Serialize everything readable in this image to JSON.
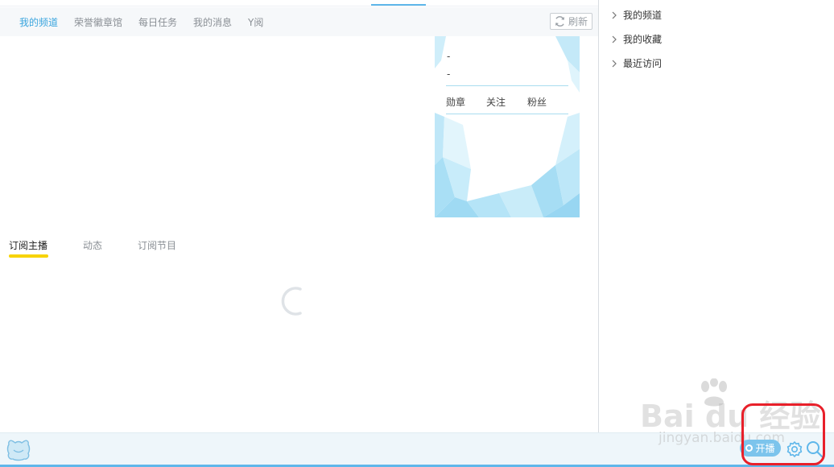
{
  "nav": {
    "tabs": [
      {
        "label": "我的频道",
        "active": true
      },
      {
        "label": "荣誉徽章馆",
        "active": false
      },
      {
        "label": "每日任务",
        "active": false
      },
      {
        "label": "我的消息",
        "active": false
      },
      {
        "label": "Y阅",
        "active": false
      }
    ],
    "refresh_label": "刷新"
  },
  "profile_card": {
    "line1": "-",
    "line2": "-",
    "stats": [
      "勋章",
      "关注",
      "粉丝"
    ]
  },
  "sub_tabs": [
    {
      "label": "订阅主播",
      "active": true
    },
    {
      "label": "动态",
      "active": false
    },
    {
      "label": "订阅节目",
      "active": false
    }
  ],
  "right_panel": {
    "items": [
      "我的频道",
      "我的收藏",
      "最近访问"
    ]
  },
  "bottom_bar": {
    "broadcast_label": "开播",
    "icons": [
      "yy-logo-icon",
      "settings-gear-icon",
      "search-icon"
    ]
  },
  "watermark": {
    "brand": "Bai du 经验",
    "url": "jingyan.baidu.com"
  },
  "colors": {
    "accent": "#3aa5de",
    "active_underline": "#f7d300",
    "highlight_annotation": "#e8202a"
  }
}
